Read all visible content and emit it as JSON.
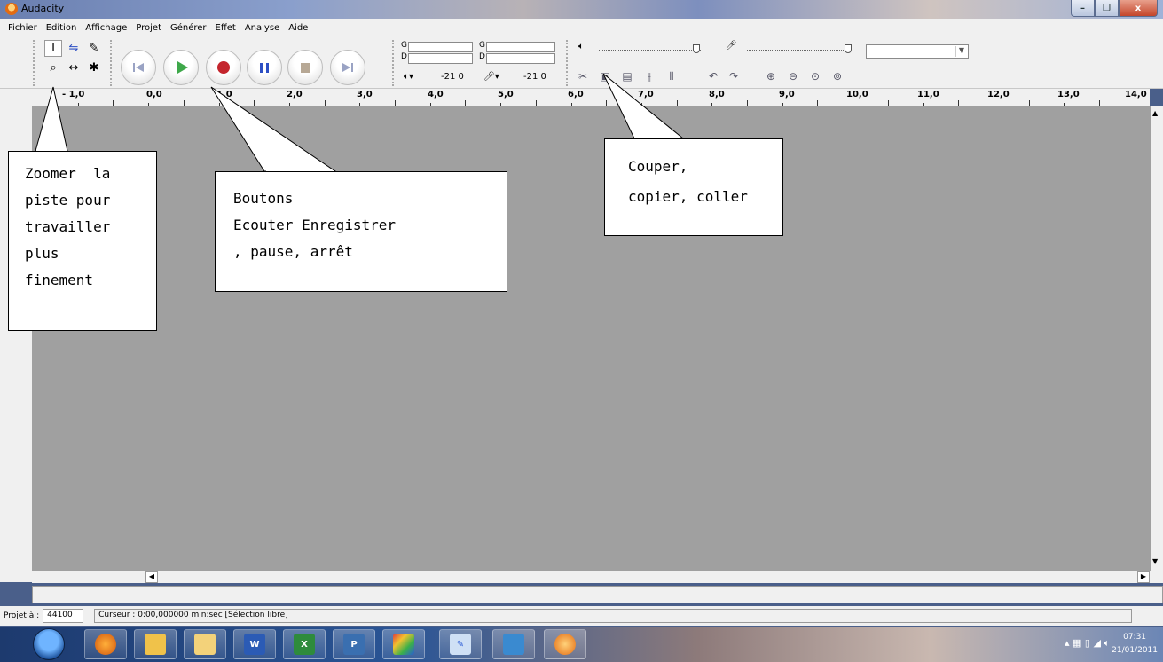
{
  "window": {
    "title": "Audacity",
    "buttons": {
      "minimize": "–",
      "maximize": "❐",
      "close": "x"
    }
  },
  "menu": [
    "Fichier",
    "Edition",
    "Affichage",
    "Projet",
    "Générer",
    "Effet",
    "Analyse",
    "Aide"
  ],
  "tools": {
    "selection": "I",
    "envelope": "⇋",
    "draw": "✎",
    "zoom": "⌕",
    "timeshift": "↔",
    "multi": "✱"
  },
  "meters": {
    "left_label": "G",
    "right_label": "D",
    "play_range": "-21  0",
    "rec_range": "-21  0"
  },
  "ruler": [
    "- 1,0",
    "0,0",
    "1,0",
    "2,0",
    "3,0",
    "4,0",
    "5,0",
    "6,0",
    "7,0",
    "8,0",
    "9,0",
    "10,0",
    "11,0",
    "12,0",
    "13,0",
    "14,0"
  ],
  "status": {
    "project_rate_label": "Projet à :",
    "project_rate": "44100",
    "cursor_text": "Curseur : 0:00,000000 min:sec  [Sélection libre]"
  },
  "clock": {
    "time": "07:31",
    "date": "21/01/2011"
  },
  "taskbar_apps": [
    "firefox",
    "outlook",
    "explorer",
    "word",
    "excel",
    "powerpoint",
    "studio",
    "editor",
    "photos",
    "audacity"
  ],
  "callouts": {
    "zoom": [
      "Zoomer  la",
      "piste pour",
      "travailler",
      "plus",
      "finement"
    ],
    "transport": [
      "Boutons",
      "Ecouter Enregistrer",
      ", pause, arrêt"
    ],
    "edit": [
      "Couper,",
      "copier, coller"
    ]
  },
  "colors": {
    "track_bg": "#a0a0a0",
    "toolbar_bg": "#f0f0f0",
    "record": "#c4252d",
    "play": "#3ea84a",
    "pause": "#2d4fc4"
  }
}
